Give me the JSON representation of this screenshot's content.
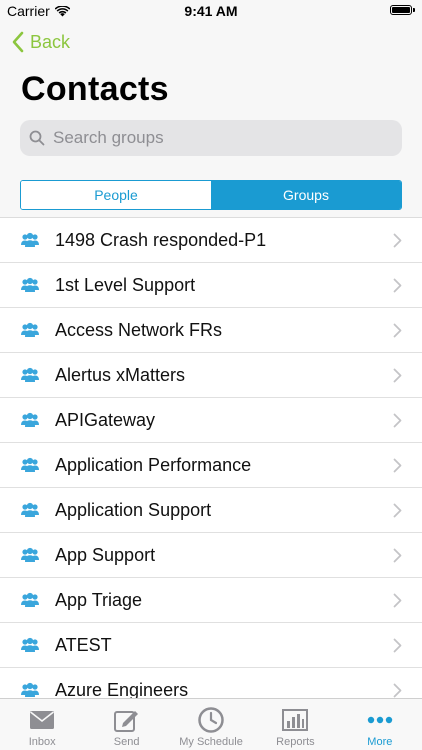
{
  "status_bar": {
    "carrier": "Carrier",
    "time": "9:41 AM"
  },
  "nav": {
    "back_label": "Back",
    "title": "Contacts"
  },
  "search": {
    "placeholder": "Search groups"
  },
  "segments": {
    "people": "People",
    "groups": "Groups",
    "selected": "Groups"
  },
  "groups": [
    {
      "label": "1498 Crash responded-P1"
    },
    {
      "label": "1st Level Support"
    },
    {
      "label": "Access Network FRs"
    },
    {
      "label": "Alertus xMatters"
    },
    {
      "label": "APIGateway"
    },
    {
      "label": "Application Performance"
    },
    {
      "label": "Application Support"
    },
    {
      "label": "App Support"
    },
    {
      "label": "App Triage"
    },
    {
      "label": "ATEST"
    },
    {
      "label": "Azure Engineers"
    }
  ],
  "tabbar": {
    "inbox": "Inbox",
    "send": "Send",
    "schedule": "My Schedule",
    "reports": "Reports",
    "more": "More",
    "active": "More"
  },
  "colors": {
    "accent": "#1a9bd2",
    "back": "#8cc63f",
    "group_icon": "#3aa6dc",
    "chevron": "#c4c4c7"
  }
}
